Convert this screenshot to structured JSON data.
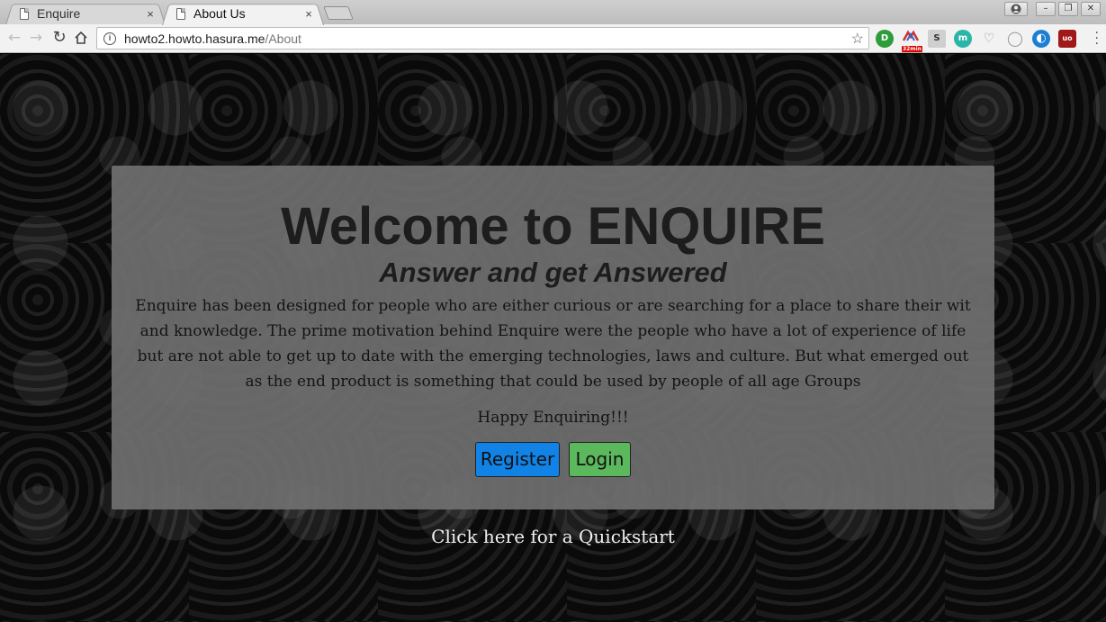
{
  "browser": {
    "tabs": [
      {
        "title": "Enquire",
        "close": "×",
        "active": false
      },
      {
        "title": "About Us",
        "close": "×",
        "active": true
      }
    ],
    "window_buttons": {
      "minimize": "–",
      "restore": "❐",
      "close": "✕"
    },
    "url_host": "howto2.howto.hasura.me",
    "url_path": "/About",
    "extensions": [
      {
        "icon": "green-circle-extension-icon",
        "color": "#2e9c3a",
        "glyph": "D"
      },
      {
        "icon": "gmail-counter-extension-icon",
        "color": "#cfcfcf",
        "glyph": "",
        "badge": "32min"
      },
      {
        "icon": "s-extension-icon",
        "color": "#bdbdbd",
        "glyph": "S"
      },
      {
        "icon": "teal-m-extension-icon",
        "color": "#2bb5a9",
        "glyph": "m"
      },
      {
        "icon": "pocket-extension-icon",
        "color": "#e0e0e0",
        "glyph": "♡"
      },
      {
        "icon": "circle-outline-extension-icon",
        "color": "#e0e0e0",
        "glyph": "◯"
      },
      {
        "icon": "blue-circle-extension-icon",
        "color": "#1d7fd1",
        "glyph": "◐"
      },
      {
        "icon": "ublock-extension-icon",
        "color": "#a01818",
        "glyph": "uo"
      }
    ]
  },
  "page": {
    "welcome_title": "Welcome to ENQUIRE",
    "tagline": "Answer and get Answered",
    "description": "Enquire has been designed for people who are either curious or are searching for a place to share their wit and knowledge. The prime motivation behind Enquire were the people who have a lot of experience of life but are not able to get up to date with the emerging technologies, laws and culture. But what emerged out as the end product is something that could be used by people of all age Groups",
    "happy": "Happy Enquiring!!!",
    "register_label": "Register",
    "login_label": "Login",
    "quickstart_label": "Click here for a Quickstart"
  },
  "colors": {
    "register": "#1283e6",
    "login": "#5cb85c",
    "card": "#707070"
  }
}
